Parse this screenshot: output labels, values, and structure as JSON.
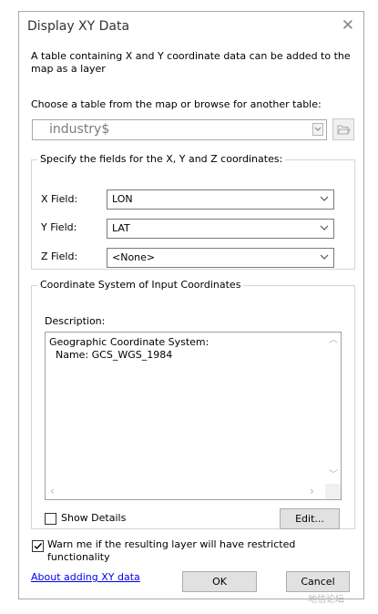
{
  "window": {
    "title": "Display XY Data",
    "close_icon": "✕"
  },
  "intro_text": "A table containing X and Y coordinate data can be added to the map as a layer",
  "choose_label": "Choose a table from the map or browse for another table:",
  "table_value": "industry$",
  "fields_group": {
    "legend": "Specify the fields for the X, Y and Z coordinates:",
    "x_label": "X Field:",
    "x_value": "LON",
    "y_label": "Y Field:",
    "y_value": "LAT",
    "z_label": "Z Field:",
    "z_value": "<None>"
  },
  "coord_group": {
    "legend": "Coordinate System of Input Coordinates",
    "description_label": "Description:",
    "description_text": "Geographic Coordinate System:\n  Name: GCS_WGS_1984",
    "show_details_label": "Show Details",
    "show_details_checked": false,
    "edit_label": "Edit..."
  },
  "warn": {
    "label": "Warn me if the resulting layer will have restricted functionality",
    "checked": true
  },
  "link_text": "About adding XY data",
  "ok_label": "OK",
  "cancel_label": "Cancel",
  "watermark": "地信论坛"
}
